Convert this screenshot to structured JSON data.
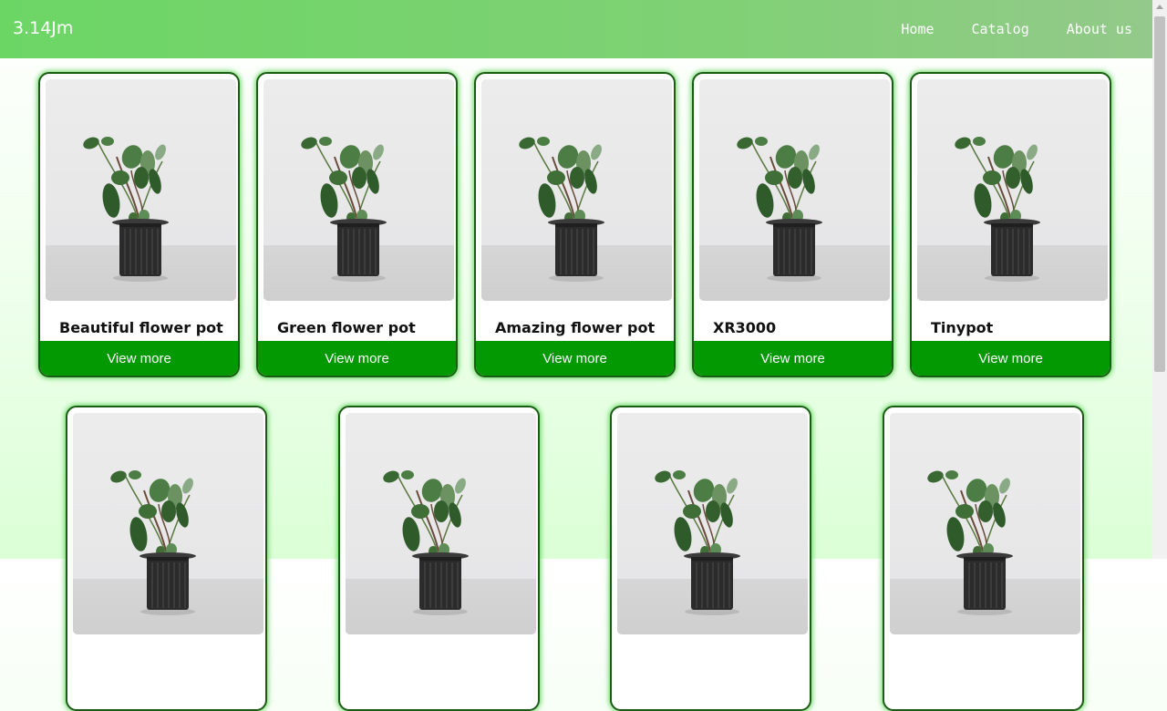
{
  "navbar": {
    "brand": "3.14Jm",
    "links": [
      "Home",
      "Catalog",
      "About us"
    ]
  },
  "products": [
    {
      "title": "Beautiful flower pot",
      "button": "View more",
      "image": "potted-plant-image"
    },
    {
      "title": "Green flower pot",
      "button": "View more",
      "image": "potted-plant-image"
    },
    {
      "title": "Amazing flower pot",
      "button": "View more",
      "image": "potted-plant-image"
    },
    {
      "title": "XR3000",
      "button": "View more",
      "image": "potted-plant-image"
    },
    {
      "title": "Tinypot",
      "button": "View more",
      "image": "potted-plant-image"
    },
    {
      "title": "",
      "button": "",
      "image": "potted-plant-image"
    },
    {
      "title": "",
      "button": "",
      "image": "potted-plant-image"
    },
    {
      "title": "",
      "button": "",
      "image": "potted-plant-image"
    },
    {
      "title": "",
      "button": "",
      "image": "potted-plant-image"
    }
  ],
  "colors": {
    "navbar_start": "#6cd665",
    "navbar_end": "#93c98a",
    "button": "#029902",
    "card_border": "#1a5c14",
    "card_glow": "#5fd25a"
  }
}
